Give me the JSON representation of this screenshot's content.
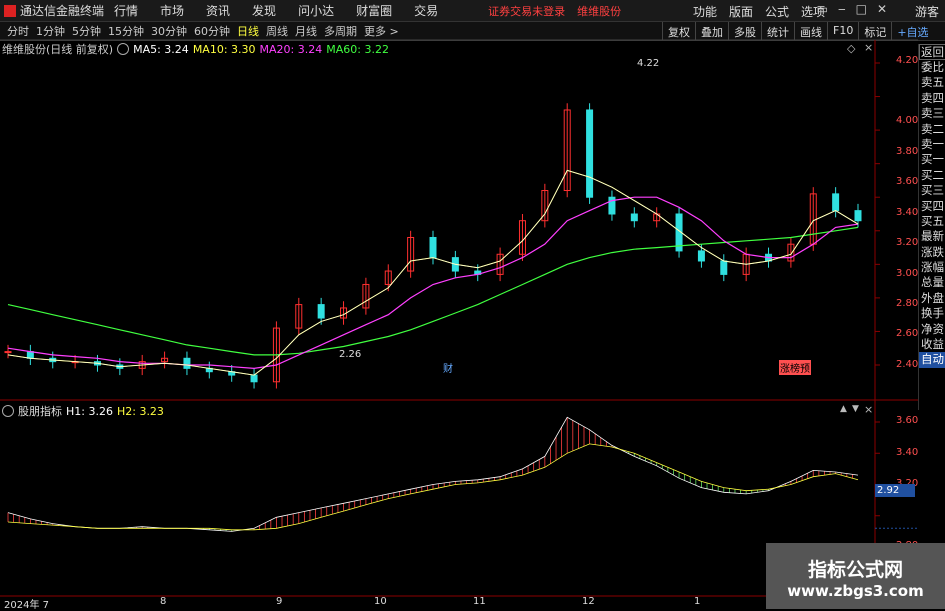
{
  "app": {
    "title": "通达信金融终端",
    "brand_color": "#d22222"
  },
  "menu": [
    "行情",
    "市场",
    "资讯",
    "发现",
    "问小达",
    "财富圈",
    "交易"
  ],
  "notice": {
    "left": "证券交易未登录",
    "right": "维维股份"
  },
  "right_menu": [
    "功能",
    "版面",
    "公式",
    "选项"
  ],
  "window_controls": {
    "restore": "▭",
    "minimize": "‒",
    "maximize": "□",
    "close": "✕"
  },
  "guest": "游客",
  "periods": [
    "分时",
    "1分钟",
    "5分钟",
    "15分钟",
    "30分钟",
    "60分钟",
    "日线",
    "周线",
    "月线",
    "多周期",
    "更多 >"
  ],
  "active_period": "日线",
  "tools": [
    "复权",
    "叠加",
    "多股",
    "统计",
    "画线",
    "F10",
    "标记",
    "+自选",
    "返回"
  ],
  "side_panel": [
    "委比",
    "卖五",
    "卖四",
    "卖三",
    "卖二",
    "卖一",
    "买一",
    "买二",
    "买三",
    "买四",
    "买五",
    "最新",
    "涨跌",
    "涨幅",
    "总量",
    "外盘",
    "换手",
    "净资",
    "收益",
    "自动"
  ],
  "main_legend": {
    "name": "维维股份(日线 前复权)",
    "ma5": "MA5: 3.24",
    "ma10": "MA10: 3.30",
    "ma20": "MA20: 3.24",
    "ma60": "MA60: 3.22",
    "colors": {
      "ma5": "#ffffff",
      "ma10": "#ffff40",
      "ma20": "#ff40ff",
      "ma60": "#40ff40"
    }
  },
  "sub_legend": {
    "name": "股朋指标",
    "h1": "H1: 3.26",
    "h2": "H2: 3.23"
  },
  "price_axis": [
    "4.20",
    "4.00",
    "3.80",
    "3.60",
    "3.40",
    "3.20",
    "3.00",
    "2.80",
    "2.60",
    "2.40"
  ],
  "sub_axis": [
    "3.60",
    "3.40",
    "3.20",
    "2.80"
  ],
  "current_value": "2.92",
  "annotations": {
    "high": "4.22",
    "low": "2.26",
    "cai": "财",
    "zhang": "涨榜预"
  },
  "dates": [
    "2024年 7",
    "8",
    "9",
    "10",
    "11",
    "12",
    "1"
  ],
  "panel_controls": {
    "up": "▲",
    "down": "▼",
    "settings": "◇",
    "close": "×"
  },
  "watermark": {
    "line1": "指标公式网",
    "line2": "www.zbgs3.com"
  },
  "chart_data": {
    "type": "line",
    "title": "维维股份(日线 前复权)",
    "y_range": [
      2.26,
      4.22
    ],
    "series": [
      {
        "name": "close",
        "values": [
          2.48,
          2.44,
          2.42,
          2.42,
          2.4,
          2.38,
          2.42,
          2.44,
          2.38,
          2.36,
          2.34,
          2.3,
          2.62,
          2.76,
          2.68,
          2.74,
          2.88,
          2.96,
          3.16,
          3.04,
          2.96,
          2.94,
          3.06,
          3.26,
          3.44,
          3.92,
          3.4,
          3.3,
          3.26,
          3.3,
          3.08,
          3.02,
          2.94,
          3.06,
          3.02,
          3.12,
          3.42,
          3.32,
          3.26
        ]
      },
      {
        "name": "MA5",
        "values": [
          2.46,
          2.44,
          2.43,
          2.42,
          2.41,
          2.39,
          2.4,
          2.41,
          2.4,
          2.38,
          2.36,
          2.34,
          2.44,
          2.58,
          2.66,
          2.7,
          2.78,
          2.86,
          3.02,
          3.04,
          3.0,
          2.98,
          3.02,
          3.14,
          3.3,
          3.56,
          3.52,
          3.46,
          3.38,
          3.3,
          3.2,
          3.1,
          3.02,
          3.0,
          3.02,
          3.06,
          3.26,
          3.32,
          3.24
        ]
      },
      {
        "name": "MA20",
        "values": [
          2.5,
          2.48,
          2.46,
          2.45,
          2.44,
          2.42,
          2.41,
          2.41,
          2.4,
          2.4,
          2.39,
          2.38,
          2.4,
          2.46,
          2.52,
          2.58,
          2.64,
          2.7,
          2.8,
          2.88,
          2.92,
          2.94,
          2.98,
          3.04,
          3.12,
          3.26,
          3.32,
          3.38,
          3.4,
          3.4,
          3.34,
          3.26,
          3.14,
          3.06,
          3.04,
          3.04,
          3.12,
          3.22,
          3.24
        ]
      },
      {
        "name": "MA60",
        "values": [
          2.76,
          2.73,
          2.7,
          2.67,
          2.64,
          2.61,
          2.58,
          2.55,
          2.52,
          2.5,
          2.48,
          2.46,
          2.46,
          2.47,
          2.49,
          2.51,
          2.54,
          2.57,
          2.61,
          2.66,
          2.71,
          2.76,
          2.82,
          2.88,
          2.94,
          3.0,
          3.04,
          3.07,
          3.09,
          3.1,
          3.11,
          3.12,
          3.13,
          3.14,
          3.15,
          3.16,
          3.18,
          3.2,
          3.22
        ]
      },
      {
        "name": "H1",
        "values": [
          3.02,
          2.98,
          2.95,
          2.93,
          2.92,
          2.92,
          2.93,
          2.92,
          2.92,
          2.91,
          2.9,
          2.92,
          2.99,
          3.02,
          3.05,
          3.08,
          3.11,
          3.14,
          3.17,
          3.2,
          3.22,
          3.23,
          3.25,
          3.3,
          3.38,
          3.63,
          3.55,
          3.45,
          3.38,
          3.32,
          3.24,
          3.18,
          3.15,
          3.14,
          3.16,
          3.22,
          3.29,
          3.28,
          3.26
        ]
      },
      {
        "name": "H2",
        "values": [
          2.96,
          2.95,
          2.94,
          2.93,
          2.92,
          2.92,
          2.92,
          2.92,
          2.92,
          2.92,
          2.91,
          2.91,
          2.92,
          2.95,
          2.99,
          3.03,
          3.07,
          3.11,
          3.14,
          3.17,
          3.2,
          3.21,
          3.23,
          3.26,
          3.31,
          3.4,
          3.46,
          3.44,
          3.4,
          3.34,
          3.28,
          3.22,
          3.18,
          3.16,
          3.17,
          3.2,
          3.25,
          3.27,
          3.23
        ]
      }
    ]
  }
}
